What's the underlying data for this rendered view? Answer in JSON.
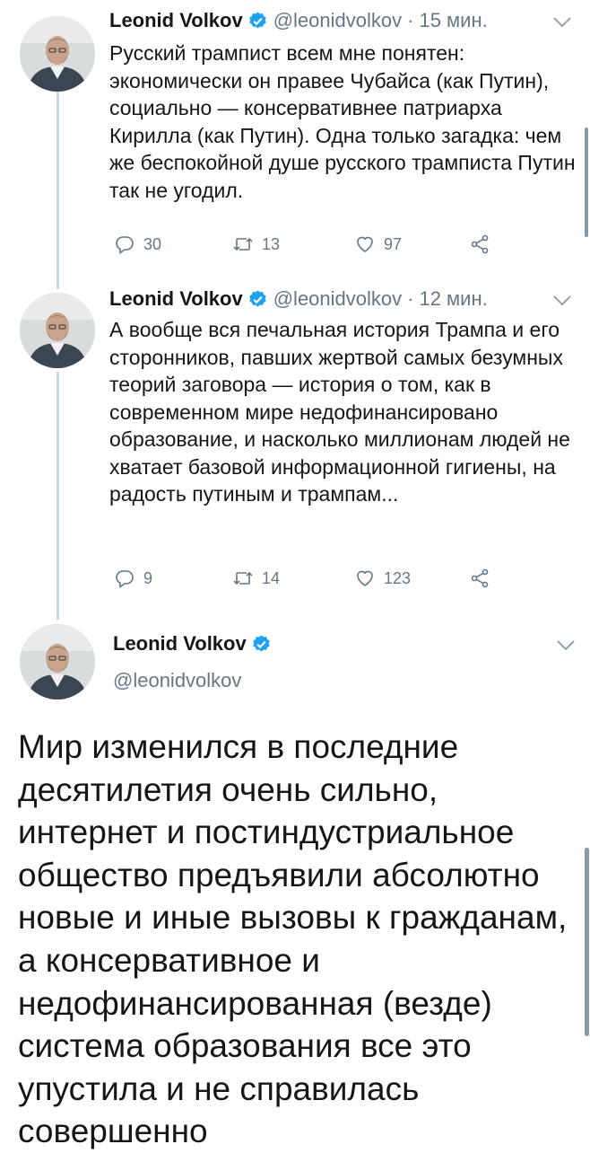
{
  "colors": {
    "verified": "#1da1f2",
    "muted": "#657786",
    "text": "#14171a",
    "thread": "#ccd6dd"
  },
  "tweets": [
    {
      "author": "Leonid Volkov",
      "handle": "@leonidvolkov",
      "separator": "·",
      "time": "15 мин.",
      "text": "Русский трампист всем мне понятен: экономически он правее Чубайса (как Путин), социально — консервативнее патриарха Кирилла (как Путин). Одна только загадка: чем же беспокойной душе русского трамписта Путин так не угодил.",
      "replies": "30",
      "retweets": "13",
      "likes": "97"
    },
    {
      "author": "Leonid Volkov",
      "handle": "@leonidvolkov",
      "separator": "·",
      "time": "12 мин.",
      "text": "А вообще вся печальная история Трампа и его сторонников, павших жертвой самых безумных теорий заговора — история о том, как в современном мире недофинансировано образование, и насколько миллионам людей не хватает базовой информационной гигиены, на радость путиным и трампам...",
      "replies": "9",
      "retweets": "14",
      "likes": "123"
    }
  ],
  "focused": {
    "author": "Leonid Volkov",
    "handle": "@leonidvolkov",
    "text": "Мир изменился в последние десятилетия очень сильно, интернет и постиндустриальное общество предъявили абсолютно новые и иные вызовы к гражданам, а консервативное и недофинансированная (везде) система образования все это упустила и не справилась совершенно"
  },
  "icons": [
    "verified-badge-icon",
    "chevron-down-icon",
    "reply-icon",
    "retweet-icon",
    "like-icon",
    "share-icon"
  ]
}
